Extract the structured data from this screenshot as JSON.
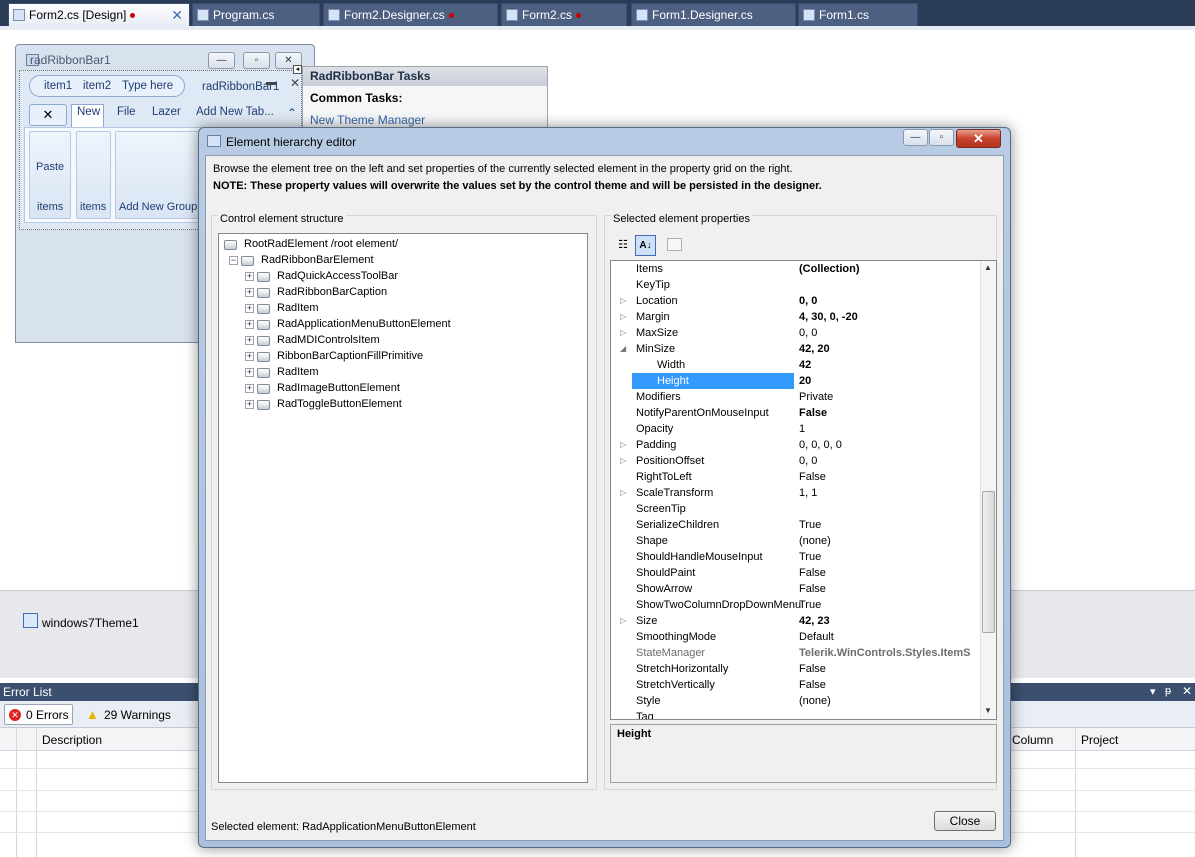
{
  "tabs": [
    {
      "label": "Form2.cs [Design]",
      "dirty": true,
      "active": true
    },
    {
      "label": "Program.cs",
      "dirty": false,
      "active": false
    },
    {
      "label": "Form2.Designer.cs",
      "dirty": true,
      "active": false
    },
    {
      "label": "Form2.cs",
      "dirty": true,
      "active": false
    },
    {
      "label": "Form1.Designer.cs",
      "dirty": false,
      "active": false
    },
    {
      "label": "Form1.cs",
      "dirty": false,
      "active": false
    }
  ],
  "ribbon": {
    "title": "radRibbonBar1",
    "qat": [
      "item1",
      "item2",
      "Type here"
    ],
    "caption": "radRibbonBar1",
    "tabs": [
      "New",
      "File",
      "Lazer",
      "Add New Tab..."
    ],
    "paste_label": "Paste",
    "groups": [
      "items",
      "items",
      "Add New Group"
    ]
  },
  "smart_tag": {
    "title": "RadRibbonBar Tasks",
    "section": "Common Tasks:",
    "link": "New Theme Manager"
  },
  "tray": {
    "component": "windows7Theme1"
  },
  "error_list": {
    "title": "Error List",
    "errors": "0 Errors",
    "warnings": "29 Warnings",
    "columns": {
      "description": "Description",
      "column": "Column",
      "project": "Project"
    }
  },
  "dialog": {
    "title": "Element hierarchy editor",
    "intro": "Browse the element tree on the left and set properties of the currently selected element in the property grid on the right.",
    "note": "NOTE: These property values will overwrite the values set by the control theme and will be persisted in the designer.",
    "tree_title": "Control element structure",
    "props_title": "Selected element properties",
    "tree": [
      {
        "label": "RootRadElement /root element/",
        "level": 0
      },
      {
        "label": "RadRibbonBarElement",
        "level": 1
      },
      {
        "label": "RadQuickAccessToolBar",
        "level": 2
      },
      {
        "label": "RadRibbonBarCaption",
        "level": 2
      },
      {
        "label": "RadItem",
        "level": 2
      },
      {
        "label": "RadApplicationMenuButtonElement",
        "level": 2
      },
      {
        "label": "RadMDIControlsItem",
        "level": 2
      },
      {
        "label": "RibbonBarCaptionFillPrimitive",
        "level": 2
      },
      {
        "label": "RadItem",
        "level": 2
      },
      {
        "label": "RadImageButtonElement",
        "level": 2
      },
      {
        "label": "RadToggleButtonElement",
        "level": 2
      }
    ],
    "properties": [
      {
        "name": "Items",
        "value": "(Collection)",
        "bold": true
      },
      {
        "name": "KeyTip",
        "value": ""
      },
      {
        "name": "Location",
        "value": "0, 0",
        "bold": true,
        "expand": "closed"
      },
      {
        "name": "Margin",
        "value": "4, 30, 0, -20",
        "bold": true,
        "expand": "closed"
      },
      {
        "name": "MaxSize",
        "value": "0, 0",
        "expand": "closed"
      },
      {
        "name": "MinSize",
        "value": "42, 20",
        "bold": true,
        "expand": "open"
      },
      {
        "name": "Width",
        "value": "42",
        "bold": true,
        "child": true
      },
      {
        "name": "Height",
        "value": "20",
        "bold": true,
        "child": true,
        "selected": true
      },
      {
        "name": "Modifiers",
        "value": "Private"
      },
      {
        "name": "NotifyParentOnMouseInput",
        "value": "False",
        "bold": true
      },
      {
        "name": "Opacity",
        "value": "1"
      },
      {
        "name": "Padding",
        "value": "0, 0, 0, 0",
        "expand": "closed"
      },
      {
        "name": "PositionOffset",
        "value": "0, 0",
        "expand": "closed"
      },
      {
        "name": "RightToLeft",
        "value": "False"
      },
      {
        "name": "ScaleTransform",
        "value": "1, 1",
        "expand": "closed"
      },
      {
        "name": "ScreenTip",
        "value": ""
      },
      {
        "name": "SerializeChildren",
        "value": "True"
      },
      {
        "name": "Shape",
        "value": "(none)"
      },
      {
        "name": "ShouldHandleMouseInput",
        "value": "True"
      },
      {
        "name": "ShouldPaint",
        "value": "False"
      },
      {
        "name": "ShowArrow",
        "value": "False"
      },
      {
        "name": "ShowTwoColumnDropDownMenu",
        "value": "True"
      },
      {
        "name": "Size",
        "value": "42, 23",
        "bold": true,
        "expand": "closed"
      },
      {
        "name": "SmoothingMode",
        "value": "Default"
      },
      {
        "name": "StateManager",
        "value": "Telerik.WinControls.Styles.ItemS",
        "bold": true,
        "grey": true
      },
      {
        "name": "StretchHorizontally",
        "value": "False"
      },
      {
        "name": "StretchVertically",
        "value": "False"
      },
      {
        "name": "Style",
        "value": "(none)"
      },
      {
        "name": "Tag",
        "value": ""
      }
    ],
    "help_title": "Height",
    "status": "Selected element: RadApplicationMenuButtonElement",
    "close_label": "Close"
  }
}
